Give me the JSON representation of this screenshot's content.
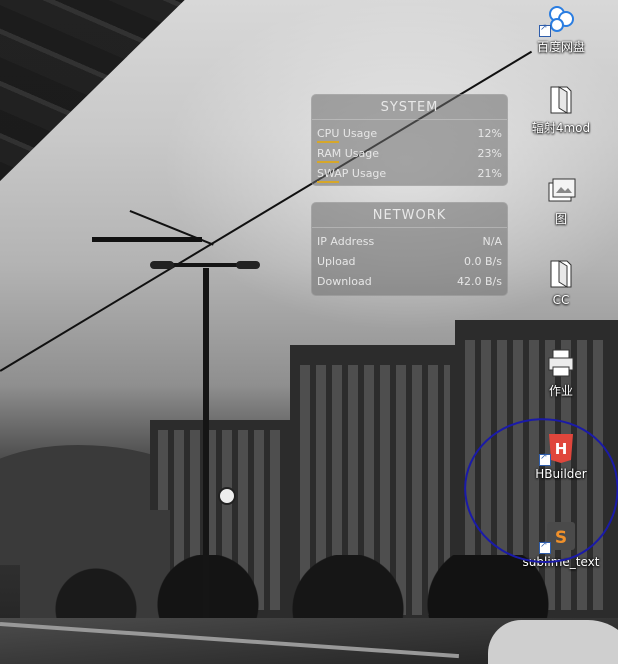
{
  "widgets": {
    "system": {
      "title": "SYSTEM",
      "rows": [
        {
          "label": "CPU Usage",
          "value": "12%"
        },
        {
          "label": "RAM Usage",
          "value": "23%"
        },
        {
          "label": "SWAP Usage",
          "value": "21%"
        }
      ]
    },
    "network": {
      "title": "NETWORK",
      "rows": [
        {
          "label": "IP Address",
          "value": "N/A"
        },
        {
          "label": "Upload",
          "value": "0.0 B/s"
        },
        {
          "label": "Download",
          "value": "42.0 B/s"
        }
      ]
    }
  },
  "desktop_icons": [
    {
      "label": "百度网盘",
      "icon": "baidu-netdisk-icon"
    },
    {
      "label": "辐射4mod",
      "icon": "folder-icon"
    },
    {
      "label": "图",
      "icon": "images-folder-icon"
    },
    {
      "label": "CC",
      "icon": "folder-icon"
    },
    {
      "label": "作业",
      "icon": "printer-folder-icon"
    },
    {
      "label": "HBuilder",
      "icon": "hbuilder-icon"
    },
    {
      "label": "sublime_text",
      "icon": "sublime-text-icon"
    }
  ],
  "colors": {
    "widget_accent": "#d6a72a",
    "annotation_stroke": "#1a1aa8",
    "hbuilder_red": "#e0463c",
    "sublime_orange": "#f0902a"
  }
}
